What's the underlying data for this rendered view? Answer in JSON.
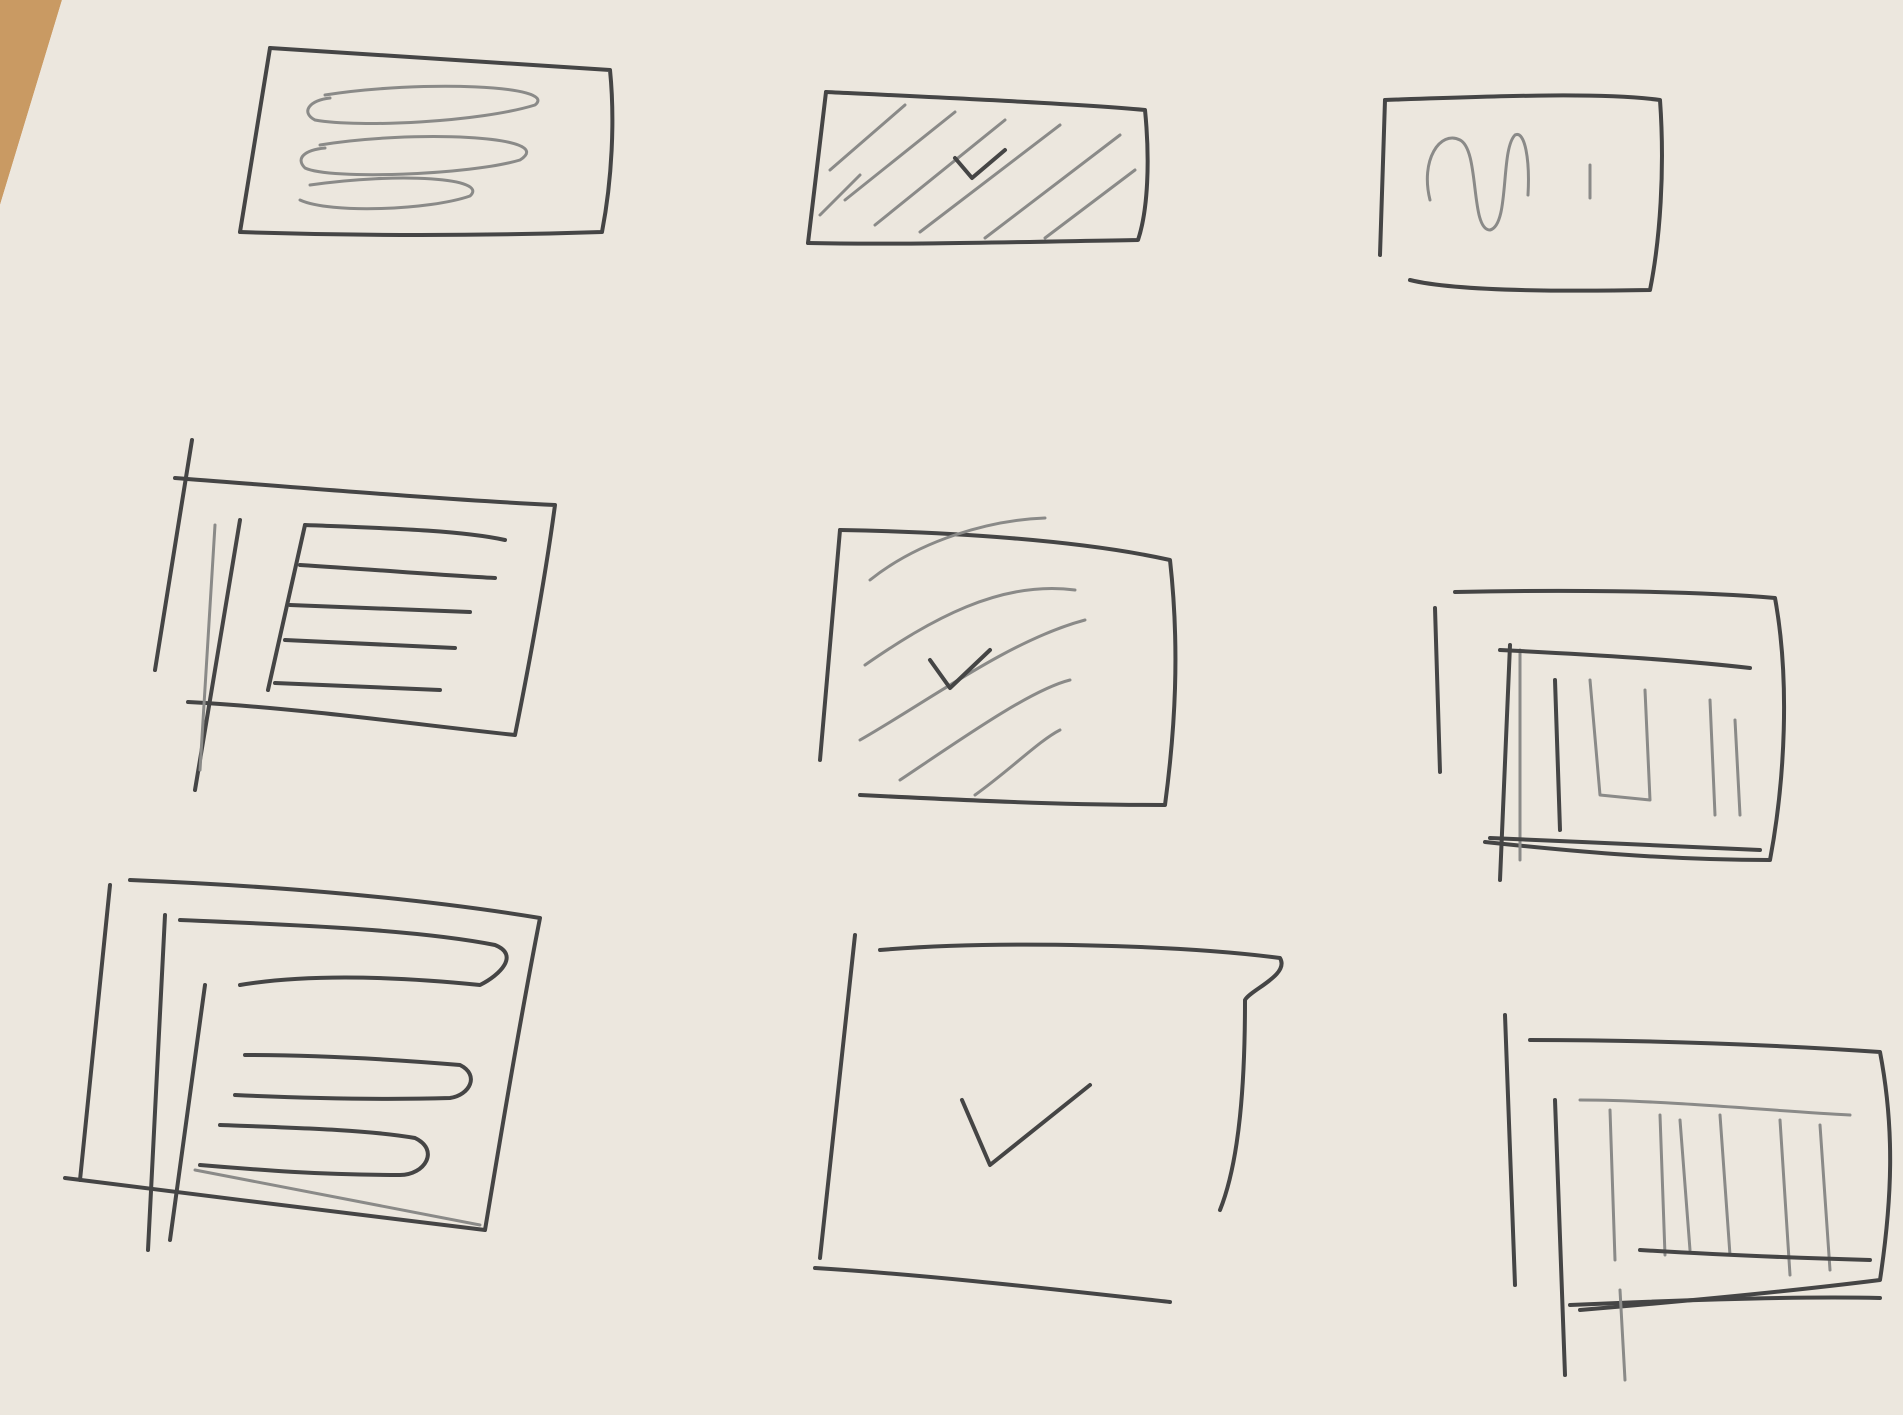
{
  "scene": {
    "subject": "pencil-sketches-on-paper",
    "paper_color": "#ece7de",
    "table_color": "#c99a63",
    "pencil_color": "#454545",
    "shade_color": "#8a8a88"
  },
  "sketches": [
    {
      "name": "sketch-text-lines-card",
      "kind": "icon-sketch"
    },
    {
      "name": "sketch-hatched-chart-card",
      "kind": "icon-sketch"
    },
    {
      "name": "sketch-wave-chart-card",
      "kind": "icon-sketch"
    },
    {
      "name": "sketch-axes-text-lines",
      "kind": "icon-sketch"
    },
    {
      "name": "sketch-hatched-check-card",
      "kind": "icon-sketch"
    },
    {
      "name": "sketch-axes-bar-chart",
      "kind": "icon-sketch"
    },
    {
      "name": "sketch-axes-rounded-bars",
      "kind": "icon-sketch"
    },
    {
      "name": "sketch-checkmark-card",
      "kind": "icon-sketch"
    },
    {
      "name": "sketch-axes-tall-bars",
      "kind": "icon-sketch"
    }
  ]
}
